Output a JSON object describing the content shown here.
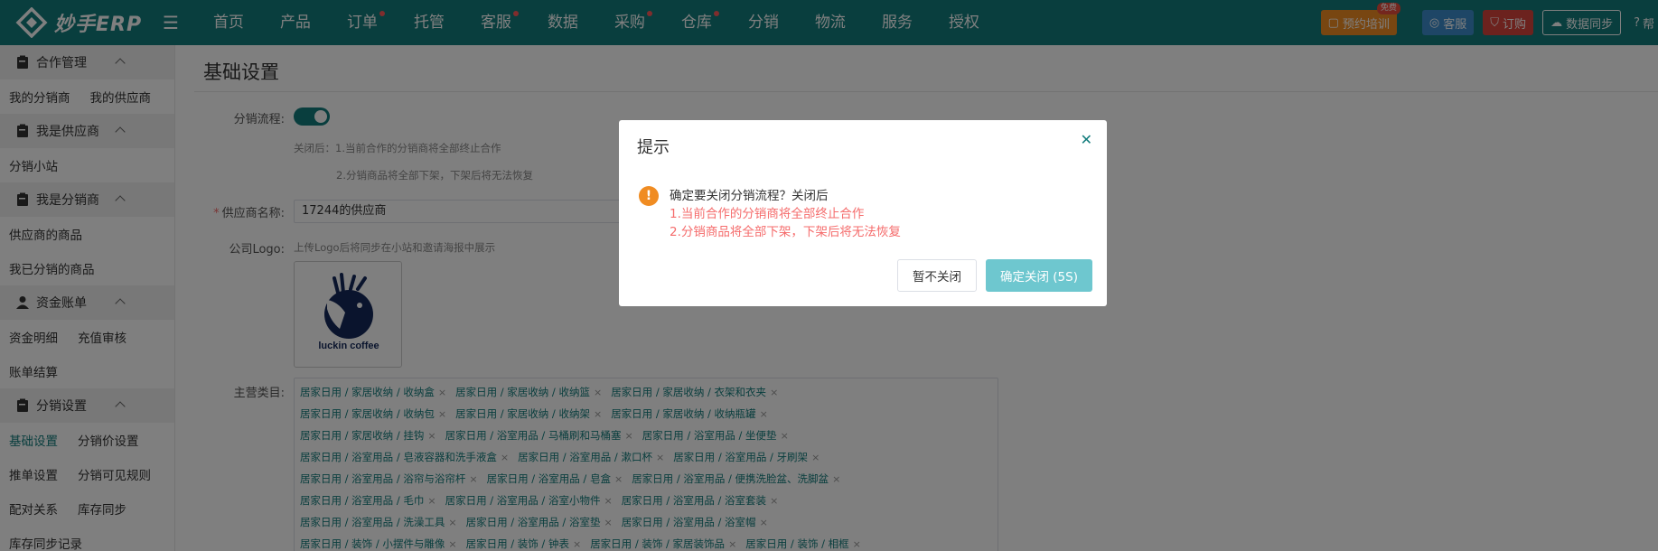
{
  "header": {
    "logo_text": "妙手ERP",
    "nav": [
      {
        "label": "首页",
        "dot": false
      },
      {
        "label": "产品",
        "dot": false
      },
      {
        "label": "订单",
        "dot": true
      },
      {
        "label": "托管",
        "dot": false
      },
      {
        "label": "客服",
        "dot": true
      },
      {
        "label": "数据",
        "dot": false
      },
      {
        "label": "采购",
        "dot": true
      },
      {
        "label": "仓库",
        "dot": true
      },
      {
        "label": "分销",
        "dot": false
      },
      {
        "label": "物流",
        "dot": false
      },
      {
        "label": "服务",
        "dot": false
      },
      {
        "label": "授权",
        "dot": false
      }
    ],
    "actions": {
      "training": "预约培训",
      "free_badge": "免费",
      "service": "客服",
      "order": "订购",
      "sync": "数据同步",
      "help": "帮"
    }
  },
  "sidebar": {
    "groups": [
      {
        "title": "合作管理",
        "rows": [
          [
            "我的分销商",
            "我的供应商"
          ]
        ]
      },
      {
        "title": "我是供应商",
        "rows": [
          [
            "分销小站"
          ]
        ]
      },
      {
        "title": "我是分销商",
        "rows": [
          [
            "供应商的商品"
          ],
          [
            "我已分销的商品"
          ]
        ]
      },
      {
        "title": "资金账单",
        "rows": [
          [
            "资金明细",
            "充值审核"
          ],
          [
            "账单结算"
          ]
        ]
      },
      {
        "title": "分销设置",
        "rows": [
          [
            "基础设置",
            "分销价设置"
          ],
          [
            "推单设置",
            "分销可见规则"
          ],
          [
            "配对关系",
            "库存同步"
          ],
          [
            "库存同步记录"
          ]
        ]
      }
    ],
    "active_item": "基础设置"
  },
  "main": {
    "title": "基础设置",
    "flow_label": "分销流程:",
    "flow_hint_1": "关闭后：1.当前合作的分销商将全部终止合作",
    "flow_hint_2": "2.分销商品将全部下架，下架后将无法恢复",
    "supplier_label": "供应商名称:",
    "supplier_value": "17244的供应商",
    "logo_label": "公司Logo:",
    "logo_hint": "上传Logo后将同步在小站和邀请海报中展示",
    "logo_caption": "luckin coffee",
    "category_label": "主营类目:",
    "tags": [
      [
        "居家日用 / 家居收纳 / 收纳盒",
        "居家日用 / 家居收纳 / 收纳篮",
        "居家日用 / 家居收纳 / 衣架和衣夹"
      ],
      [
        "居家日用 / 家居收纳 / 收纳包",
        "居家日用 / 家居收纳 / 收纳架",
        "居家日用 / 家居收纳 / 收纳瓶罐"
      ],
      [
        "居家日用 / 家居收纳 / 挂钩",
        "居家日用 / 浴室用品 / 马桶刷和马桶塞",
        "居家日用 / 浴室用品 / 坐便垫"
      ],
      [
        "居家日用 / 浴室用品 / 皂液容器和洗手液盒",
        "居家日用 / 浴室用品 / 漱口杯",
        "居家日用 / 浴室用品 / 牙刷架"
      ],
      [
        "居家日用 / 浴室用品 / 浴帘与浴帘杆",
        "居家日用 / 浴室用品 / 皂盒",
        "居家日用 / 浴室用品 / 便携洗脸盆、洗脚盆"
      ],
      [
        "居家日用 / 浴室用品 / 毛巾",
        "居家日用 / 浴室用品 / 浴室小物件",
        "居家日用 / 浴室用品 / 浴室套装"
      ],
      [
        "居家日用 / 浴室用品 / 洗澡工具",
        "居家日用 / 浴室用品 / 浴室垫",
        "居家日用 / 浴室用品 / 浴室帽"
      ],
      [
        "居家日用 / 装饰 / 小摆件与雕像",
        "居家日用 / 装饰 / 钟表",
        "居家日用 / 装饰 / 家居装饰品",
        "居家日用 / 装饰 / 相框"
      ]
    ]
  },
  "dialog": {
    "title": "提示",
    "message": "确定要关闭分销流程？关闭后",
    "line_1": "1.当前合作的分销商将全部终止合作",
    "line_2": "2.分销商品将全部下架，下架后将无法恢复",
    "cancel": "暂不关闭",
    "confirm": "确定关闭 (5S)"
  },
  "colors": {
    "brand": "#127c7c",
    "danger": "#f56c6c",
    "warning": "#f08c22",
    "confirm_disabled": "#6ec7cf"
  }
}
